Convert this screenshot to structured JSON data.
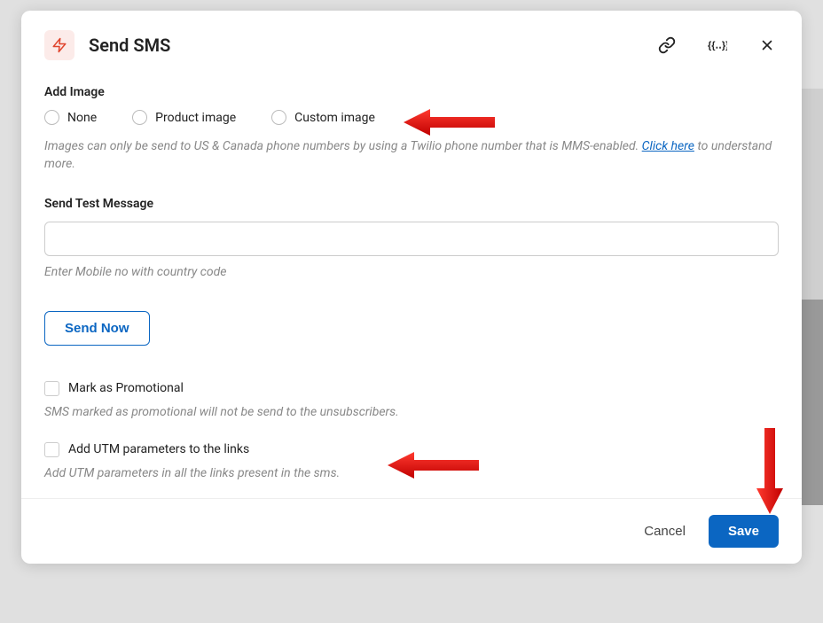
{
  "header": {
    "title": "Send SMS"
  },
  "addImage": {
    "label": "Add Image",
    "options": {
      "none": "None",
      "product": "Product image",
      "custom": "Custom image"
    },
    "helper_prefix": "Images can only be send to US & Canada phone numbers by using a Twilio phone number that is MMS-enabled. ",
    "helper_link": "Click here",
    "helper_suffix": " to understand more."
  },
  "testMessage": {
    "label": "Send Test Message",
    "value": "",
    "helper": "Enter Mobile no with country code",
    "button": "Send Now"
  },
  "promotional": {
    "label": "Mark as Promotional",
    "helper": "SMS marked as promotional will not be send to the unsubscribers."
  },
  "utm": {
    "label": "Add UTM parameters to the links",
    "helper": "Add UTM parameters in all the links present in the sms."
  },
  "footer": {
    "cancel": "Cancel",
    "save": "Save"
  }
}
